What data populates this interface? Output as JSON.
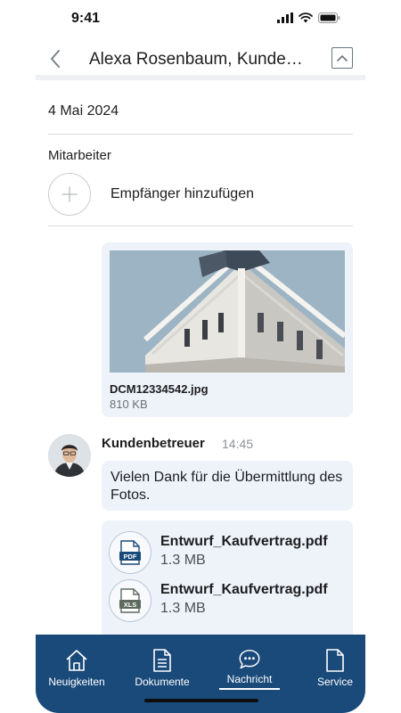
{
  "status_bar": {
    "time": "9:41"
  },
  "header": {
    "title": "Alexa Rosenbaum, Kundenbetreuer"
  },
  "date": "4 Mai 2024",
  "recipients": {
    "section_label": "Mitarbeiter",
    "add_label": "Empfänger hinzufügen"
  },
  "messages": {
    "image_attachment": {
      "file_name": "DCM12334542.jpg",
      "file_size": "810 KB"
    },
    "incoming": {
      "sender": "Kundenbetreuer",
      "time": "14:45",
      "text": "Vielen Dank für die Übermittlung des Fotos.",
      "attachments": [
        {
          "icon": "pdf-file-icon",
          "badge": "PDF",
          "name": "Entwurf_Kaufvertrag.pdf",
          "size": "1.3 MB"
        },
        {
          "icon": "xls-file-icon",
          "badge": "XLS",
          "name": "Entwurf_Kaufvertrag.pdf",
          "size": "1.3 MB"
        }
      ]
    }
  },
  "tabbar": {
    "active": "Nachricht",
    "background": "#1a4a7a",
    "items": [
      {
        "label": "Neuigkeiten",
        "icon": "home-icon"
      },
      {
        "label": "Dokumente",
        "icon": "document-icon"
      },
      {
        "label": "Nachricht",
        "icon": "chat-icon"
      },
      {
        "label": "Service",
        "icon": "service-icon"
      }
    ]
  },
  "colors": {
    "bubble": "#eef3fa",
    "accent": "#1a4a7a"
  }
}
